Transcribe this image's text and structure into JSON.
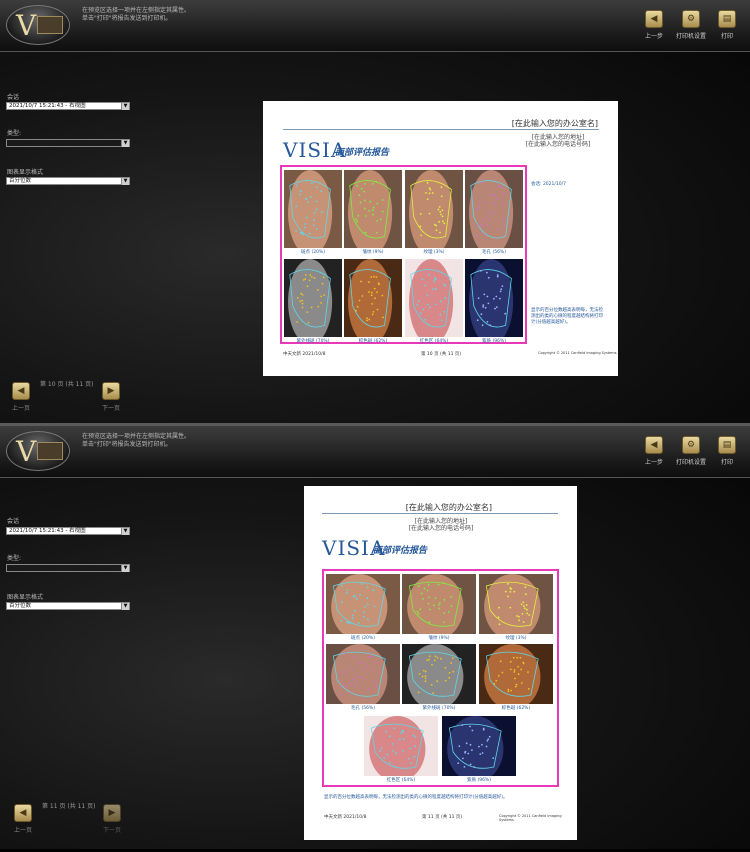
{
  "instruction_line1": "在预览区选择一项并在左侧指定其属性。",
  "instruction_line2": "单击\"打印\"将报告发送到打印机。",
  "toolbar": {
    "back": "上一步",
    "printer_settings": "打印机设置",
    "print": "打印"
  },
  "form": {
    "session_label": "会话",
    "session_value": "2021/10/7 15:21:43 - 右视图",
    "type_label": "类型:",
    "type_value": "",
    "chart_format_label": "图表显示格式",
    "chart_format_value": "百分位数"
  },
  "nav": {
    "prev": "上一页",
    "next": "下一页"
  },
  "report": {
    "office_name": "[在此输入您的办公室名]",
    "address": "[在此输入您的地址]",
    "phone": "[在此输入您的电话号码]",
    "logo": "VISIA",
    "title": "面部评估报告",
    "date_line": "会话: 2021/10/7",
    "footer_left": "中天文新 2021/10/8",
    "copyright": "Copyright © 2011 Canfield Imaging Systems",
    "note": "显示的百分位数越高表明每，无法检测出的类的心微的程度越结构将打印计(分值越高越好)。"
  },
  "screens": [
    {
      "page_indicator": "第 10 页 (共 11 页)",
      "footer_page": "第 10 页 (共 11 页)",
      "captions": [
        "斑点 (20%)",
        "皱纹 (9%)",
        "纹理 (3%)",
        "毛孔 (56%)",
        "紫外线斑 (70%)",
        "棕色斑 (62%)",
        "红色区 (64%)",
        "紫质 (96%)"
      ]
    },
    {
      "page_indicator": "第 11 页 (共 11 页)",
      "footer_page": "第 11 页 (共 11 页)",
      "captions": [
        "斑点 (20%)",
        "皱纹 (9%)",
        "纹理 (3%)",
        "毛孔 (56%)",
        "紫外线斑 (70%)",
        "棕色斑 (62%)",
        "红色区 (64%)",
        "紫质 (96%)"
      ]
    }
  ],
  "colors": {
    "accent_gold": "#c9b27a",
    "frame_pink": "#e83ab8",
    "visia_blue": "#26589a"
  }
}
